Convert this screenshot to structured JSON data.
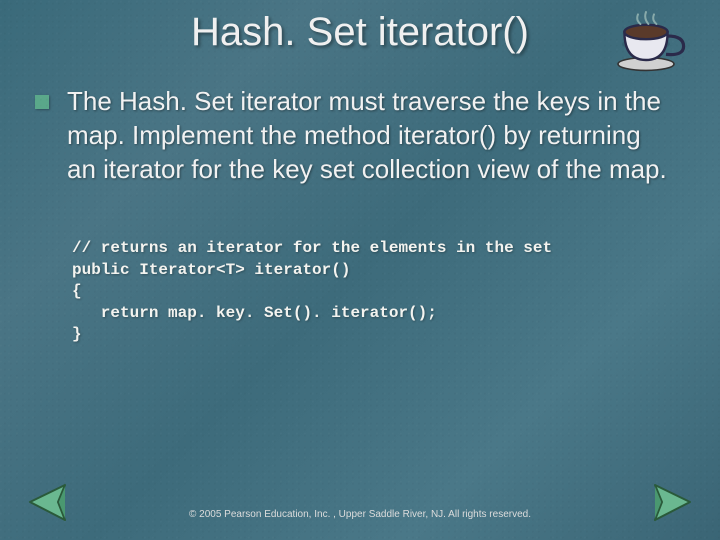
{
  "slide": {
    "title": "Hash. Set iterator()",
    "body": "The Hash. Set iterator must traverse the keys in the map. Implement the method iterator() by returning an iterator for the key set collection view of the map.",
    "code_lines": [
      "// returns an iterator for the elements in the set",
      "public Iterator<T> iterator()",
      "{",
      "   return map. key. Set(). iterator();",
      "}"
    ],
    "footer": "© 2005 Pearson Education, Inc. , Upper Saddle River, NJ.  All rights reserved."
  },
  "icons": {
    "coffee": "coffee-cup-icon",
    "prev": "arrow-left-icon",
    "next": "arrow-right-icon"
  }
}
